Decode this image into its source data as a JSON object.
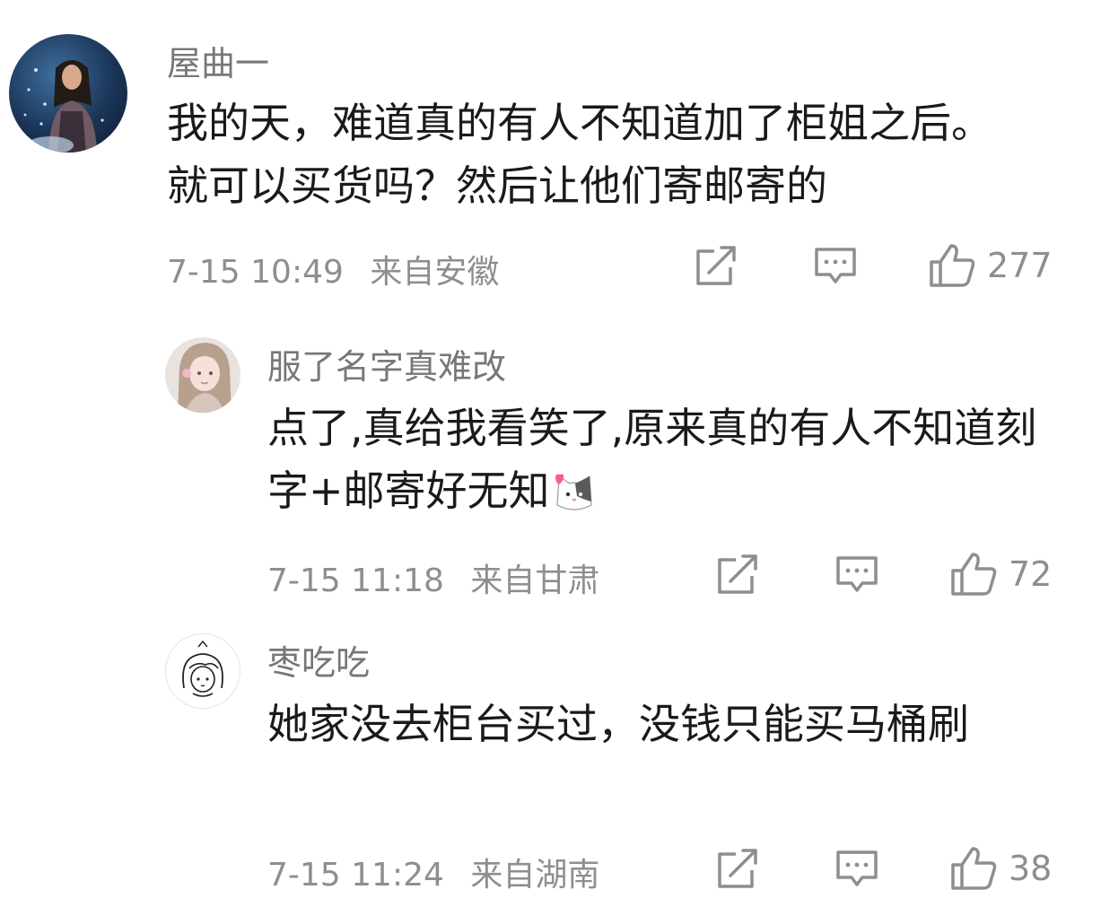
{
  "comments": [
    {
      "username": "屋曲一",
      "text": "我的天，难道真的有人不知道加了柜姐之后。就可以买货吗？然后让他们寄邮寄的",
      "time": "7-15 10:49",
      "location": "来自安徽",
      "likes": "277",
      "avatar": "photo-avatar-woman-water"
    },
    {
      "username": "服了名字真难改",
      "text": "点了,真给我看笑了,原来真的有人不知道刻字+邮寄好无知",
      "emoji": "cat-face-heart-emoji",
      "time": "7-15 11:18",
      "location": "来自甘肃",
      "likes": "72",
      "avatar": "photo-avatar-girl"
    },
    {
      "username": "枣吃吃",
      "text": "她家没去柜台买过，没钱只能买马桶刷",
      "time": "7-15 11:24",
      "location": "来自湖南",
      "likes": "38",
      "avatar": "sketch-avatar-girl"
    }
  ],
  "icons": {
    "share": "share-icon",
    "comment": "comment-icon",
    "like": "thumbs-up-icon"
  },
  "colors": {
    "text": "#1a1a1a",
    "secondary": "#8e8e8e",
    "username": "#777777",
    "background": "#ffffff"
  }
}
